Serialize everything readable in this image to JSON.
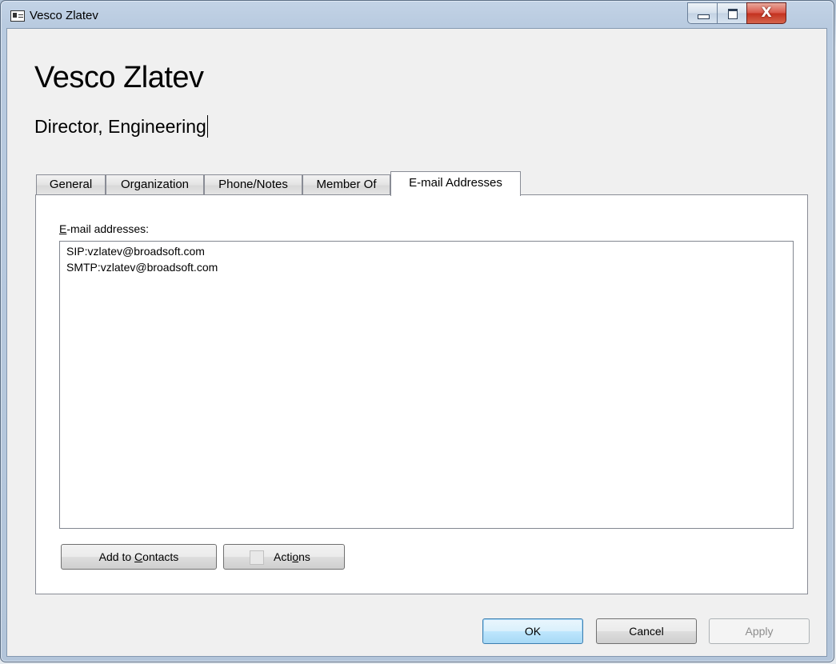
{
  "window": {
    "title": "Vesco Zlatev",
    "close_glyph": "X"
  },
  "header": {
    "name": "Vesco Zlatev",
    "job_title": "Director, Engineering"
  },
  "tabs": [
    {
      "label": "General"
    },
    {
      "label": "Organization"
    },
    {
      "label": "Phone/Notes"
    },
    {
      "label": "Member Of"
    },
    {
      "label": "E-mail Addresses",
      "active": true
    }
  ],
  "email_panel": {
    "label_accel": "E",
    "label_rest": "-mail addresses:",
    "addresses": [
      "SIP:vzlatev@broadsoft.com",
      "SMTP:vzlatev@broadsoft.com"
    ]
  },
  "buttons": {
    "add_to_contacts_pre": "Add to ",
    "add_to_contacts_accel": "C",
    "add_to_contacts_post": "ontacts",
    "actions_pre": "Acti",
    "actions_accel": "o",
    "actions_post": "ns",
    "ok": "OK",
    "cancel": "Cancel",
    "apply": "Apply"
  },
  "icons": {
    "window_icon": "contact-card-icon",
    "actions_icon": "actions-icon"
  },
  "colors": {
    "ok_accent": "#3c7fb1",
    "close_button": "#c3321f"
  }
}
